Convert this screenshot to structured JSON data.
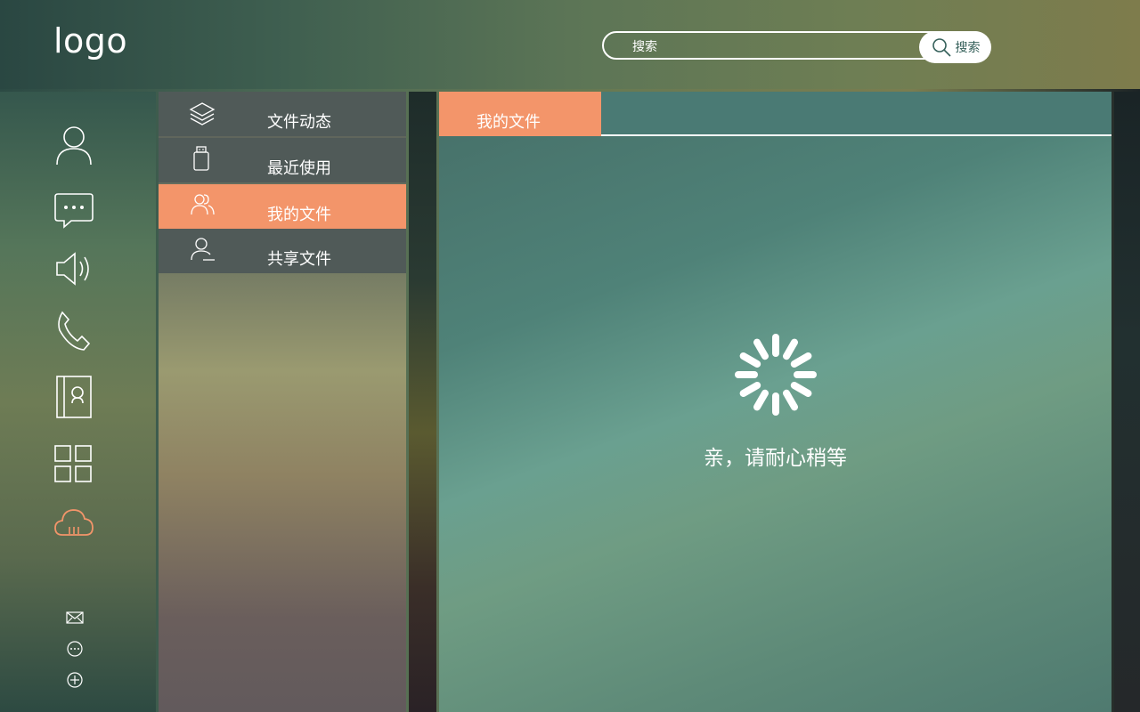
{
  "header": {
    "logo": "logo",
    "search_placeholder": "搜索",
    "search_button_label": "搜索"
  },
  "sidebar": {
    "icons": [
      "user-icon",
      "chat-icon",
      "speaker-icon",
      "phone-icon",
      "contacts-icon",
      "apps-grid-icon",
      "cloud-icon"
    ],
    "active_icon": "cloud-icon",
    "bottom_icons": [
      "mail-icon",
      "more-icon",
      "add-icon"
    ]
  },
  "menu": {
    "items": [
      {
        "label": "文件动态",
        "icon": "layers-icon"
      },
      {
        "label": "最近使用",
        "icon": "usb-drive-icon"
      },
      {
        "label": "我的文件",
        "icon": "users-icon",
        "active": true
      },
      {
        "label": "共享文件",
        "icon": "user-share-icon"
      }
    ]
  },
  "main": {
    "tab_label": "我的文件",
    "loading_text": "亲，请耐心稍等"
  },
  "colors": {
    "accent": "#f3956a",
    "menu_item_bg": "#505a58",
    "tab_bar_bg": "#4a7a74"
  }
}
